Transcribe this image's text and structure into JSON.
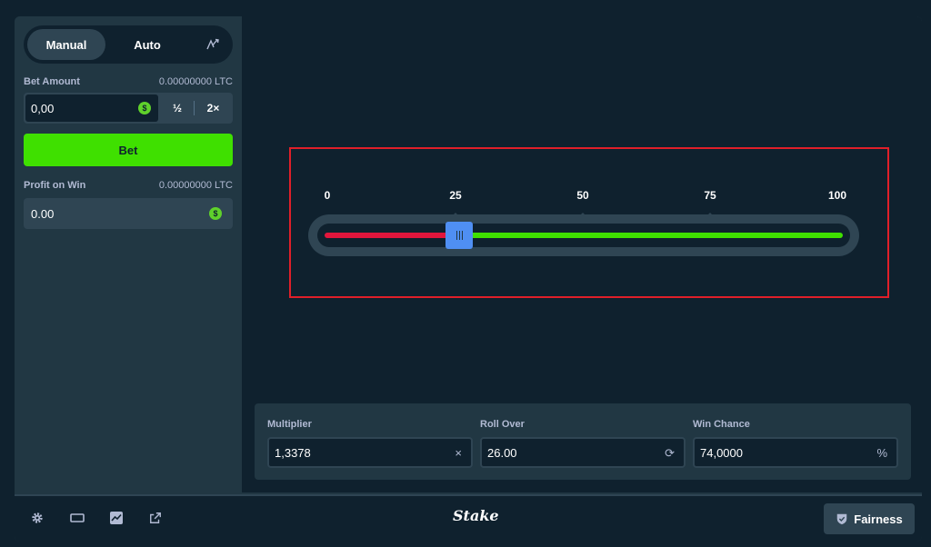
{
  "sidebar": {
    "modes": {
      "manual": "Manual",
      "auto": "Auto",
      "icon": "auto-bet-icon"
    },
    "bet_amount": {
      "label": "Bet Amount",
      "balance": "0.00000000 LTC",
      "value": "0,00",
      "coin": "$",
      "half": "½",
      "double": "2×"
    },
    "bet_button": "Bet",
    "profit": {
      "label": "Profit on Win",
      "balance": "0.00000000 LTC",
      "value": "0.00",
      "coin": "$"
    }
  },
  "game": {
    "ticks": [
      "0",
      "25",
      "50",
      "75",
      "100"
    ],
    "slider_value": 26,
    "colors": {
      "lose": "#e1163c",
      "win": "#3fe000",
      "thumb": "#4f8ff3",
      "highlight": "#e01f29"
    }
  },
  "stats": {
    "multiplier": {
      "label": "Multiplier",
      "value": "1,3378",
      "icon": "×"
    },
    "roll_over": {
      "label": "Roll Over",
      "value": "26.00",
      "icon": "⟳"
    },
    "win_chance": {
      "label": "Win Chance",
      "value": "74,0000",
      "icon": "%"
    }
  },
  "footer": {
    "icons": [
      "gear-icon",
      "theatre-mode-icon",
      "stats-chart-icon",
      "popout-icon"
    ],
    "logo": "Stake",
    "fairness": "Fairness"
  }
}
